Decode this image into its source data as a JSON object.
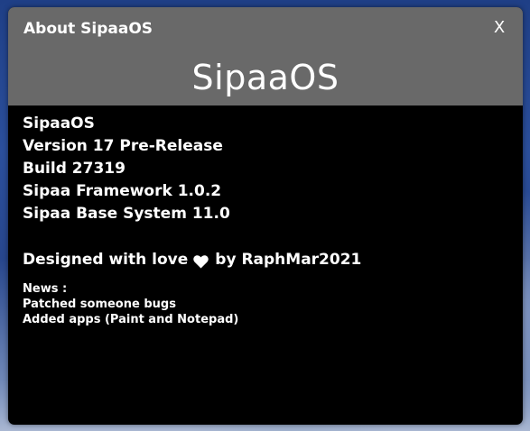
{
  "window": {
    "title": "About SipaaOS",
    "close_label": "X",
    "logo_text": "SipaaOS"
  },
  "info": {
    "name": "SipaaOS",
    "version": "Version 17 Pre-Release",
    "build": "Build 27319",
    "framework": "Sipaa Framework 1.0.2",
    "base_system": "Sipaa Base System 11.0"
  },
  "credits": {
    "prefix": "Designed with love",
    "icon": "heart-icon",
    "suffix": "by RaphMar2021"
  },
  "news": {
    "heading": "News :",
    "items": [
      "Patched someone bugs",
      "Added apps (Paint and Notepad)"
    ]
  }
}
